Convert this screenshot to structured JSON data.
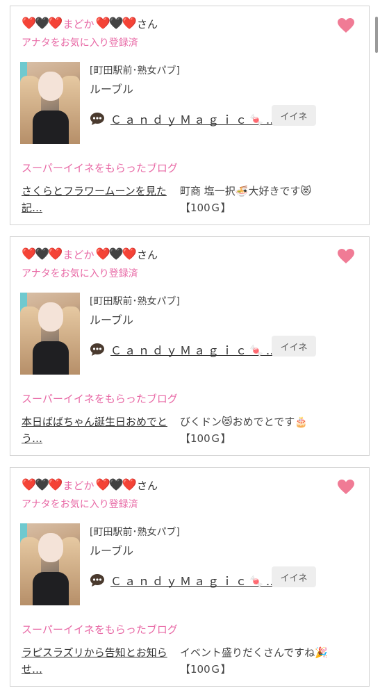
{
  "colors": {
    "accent_pink": "#e86aa6",
    "heart": "#f07b95",
    "border": "#d2d2d2",
    "button_bg": "#eeeeee"
  },
  "cards": [
    {
      "user": {
        "emoji_prefix": "❤️🖤❤️",
        "name": "まどか",
        "emoji_suffix": "❤️🖤❤️",
        "honorific": "さん"
      },
      "fav_status": "アナタをお気に入り登録済",
      "shop": "[町田駅前･熟女パブ]",
      "cast_name": "ルーブル",
      "blog_link": "ＣａｎｄｙＭａｇｉｃ🍬…",
      "like_label": "イイネ",
      "section_label": "スーパーイイネをもらったブログ",
      "post_title": "さくらとフラワームーンを見た記…",
      "comment": "町商 塩一択🍜大好きです😻",
      "points": "【100Ｇ】"
    },
    {
      "user": {
        "emoji_prefix": "❤️🖤❤️",
        "name": "まどか",
        "emoji_suffix": "❤️🖤❤️",
        "honorific": "さん"
      },
      "fav_status": "アナタをお気に入り登録済",
      "shop": "[町田駅前･熟女パブ]",
      "cast_name": "ルーブル",
      "blog_link": "ＣａｎｄｙＭａｇｉｃ🍬…",
      "like_label": "イイネ",
      "section_label": "スーパーイイネをもらったブログ",
      "post_title": "本日ばばちゃん誕生日おめでとう…",
      "comment": "びくドン😻おめでとです🎂",
      "points": "【100Ｇ】"
    },
    {
      "user": {
        "emoji_prefix": "❤️🖤❤️",
        "name": "まどか",
        "emoji_suffix": "❤️🖤❤️",
        "honorific": "さん"
      },
      "fav_status": "アナタをお気に入り登録済",
      "shop": "[町田駅前･熟女パブ]",
      "cast_name": "ルーブル",
      "blog_link": "ＣａｎｄｙＭａｇｉｃ🍬…",
      "like_label": "イイネ",
      "section_label": "スーパーイイネをもらったブログ",
      "post_title": "ラピスラズリから告知とお知らせ…",
      "comment": "イベント盛りだくさんですね🎉",
      "points": "【100Ｇ】"
    }
  ]
}
